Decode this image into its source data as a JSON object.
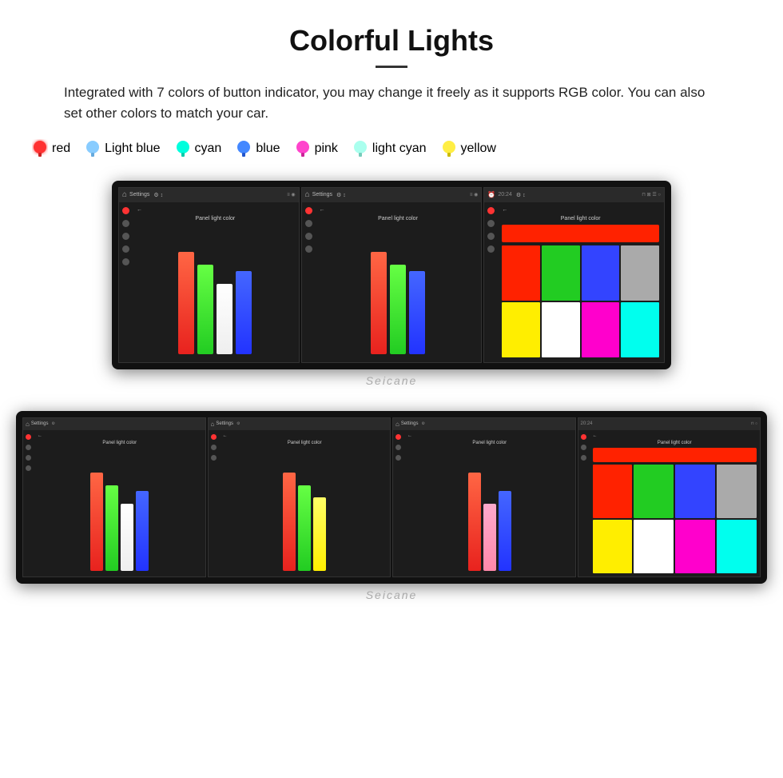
{
  "header": {
    "title": "Colorful Lights",
    "description": "Integrated with 7 colors of button indicator, you may change it freely as it supports RGB color. You can also set other colors to match your car."
  },
  "colors": [
    {
      "name": "red",
      "color": "#ff3333",
      "glowColor": "#ff6666"
    },
    {
      "name": "Light blue",
      "color": "#88ccff",
      "glowColor": "#aaddff"
    },
    {
      "name": "cyan",
      "color": "#00ffdd",
      "glowColor": "#66ffee"
    },
    {
      "name": "blue",
      "color": "#4488ff",
      "glowColor": "#6699ff"
    },
    {
      "name": "pink",
      "color": "#ff44cc",
      "glowColor": "#ff88dd"
    },
    {
      "name": "light cyan",
      "color": "#aaffee",
      "glowColor": "#ccffff"
    },
    {
      "name": "yellow",
      "color": "#ffee44",
      "glowColor": "#ffff88"
    }
  ],
  "screens_top": [
    {
      "bars": [
        {
          "color": "#e8221e",
          "height": "85%"
        },
        {
          "color": "#22cc22",
          "height": "75%"
        },
        {
          "color": "#ffffff",
          "height": "60%"
        },
        {
          "color": "#3344ff",
          "height": "70%"
        }
      ],
      "sideIcons": [
        "#ff3333",
        "#888888",
        "#888888",
        "#888888",
        "#888888"
      ]
    },
    {
      "bars": [
        {
          "color": "#e8221e",
          "height": "85%"
        },
        {
          "color": "#22cc22",
          "height": "75%"
        },
        {
          "color": "#3344ff",
          "height": "70%"
        }
      ],
      "sideIcons": [
        "#ff3333",
        "#888888",
        "#888888",
        "#888888",
        "#888888"
      ]
    },
    {
      "swatches": [
        "#ff2200",
        "#22cc22",
        "#3344ff",
        "#aaaaaa",
        "#ff2200",
        "#22cc22",
        "#3344ff",
        "#aaaaaa",
        "#ffee00",
        "#ffffff",
        "#ff00cc",
        "#ffffff"
      ],
      "topBar": {
        "color": "#ff2200",
        "fullWidth": true
      },
      "sideIcons": [
        "#ff3333",
        "#888888",
        "#888888",
        "#888888",
        "#888888"
      ]
    }
  ],
  "screens_bottom": [
    {
      "bars": [
        {
          "color": "#e8221e",
          "height": "85%"
        },
        {
          "color": "#22cc22",
          "height": "75%"
        },
        {
          "color": "#ffffff",
          "height": "60%"
        },
        {
          "color": "#3344ff",
          "height": "70%"
        }
      ]
    },
    {
      "bars": [
        {
          "color": "#e8221e",
          "height": "85%"
        },
        {
          "color": "#22cc22",
          "height": "75%"
        },
        {
          "color": "#ffee00",
          "height": "65%"
        }
      ]
    },
    {
      "bars": [
        {
          "color": "#e8221e",
          "height": "85%"
        },
        {
          "color": "#ff88aa",
          "height": "60%"
        },
        {
          "color": "#3344ff",
          "height": "70%"
        }
      ]
    },
    {
      "swatches": [
        "#ff2200",
        "#22cc22",
        "#3344ff",
        "#aaaaaa",
        "#ff2200",
        "#22cc22",
        "#3344ff",
        "#aaaaaa",
        "#ffee00",
        "#ffffff",
        "#ff00cc",
        "#ffffff"
      ],
      "topBar": {
        "color": "#ff2200",
        "fullWidth": true
      }
    }
  ],
  "watermark": "Seicane"
}
